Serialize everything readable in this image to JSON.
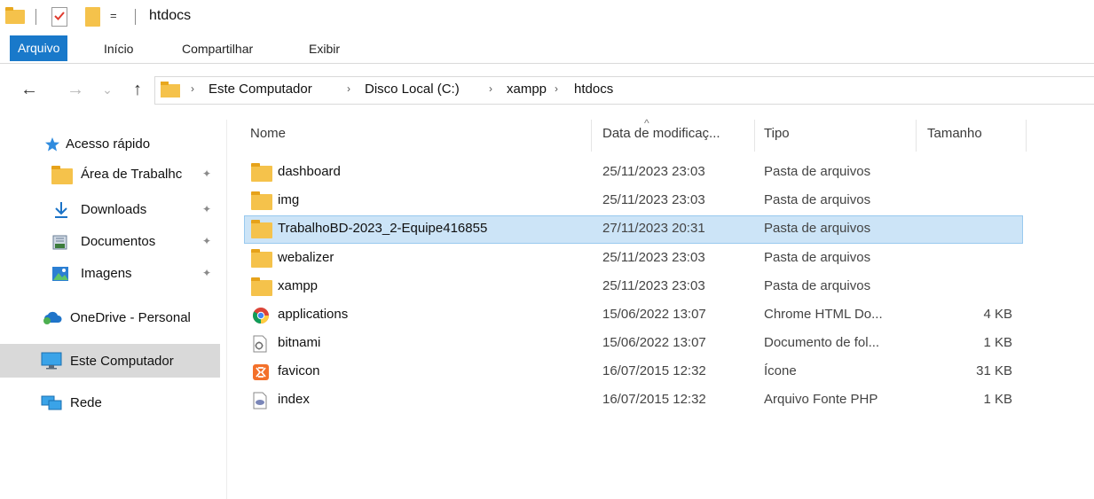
{
  "window": {
    "title": "htdocs",
    "quick_access_dropdown": "="
  },
  "ribbon": {
    "tabs": [
      {
        "label": "Arquivo",
        "active": true
      },
      {
        "label": "Início",
        "active": false
      },
      {
        "label": "Compartilhar",
        "active": false
      },
      {
        "label": "Exibir",
        "active": false
      }
    ]
  },
  "nav": {
    "back": "←",
    "forward": "→",
    "recent": "⌄",
    "up": "↑",
    "breadcrumb": [
      "Este Computador",
      "Disco Local (C:)",
      "xampp",
      "htdocs"
    ],
    "separator": "›"
  },
  "sidebar": {
    "items": [
      {
        "label": "Acesso rápido",
        "icon": "star-icon"
      },
      {
        "label": "Área de Trabalhc",
        "icon": "folder-icon",
        "pinned": true
      },
      {
        "label": "Downloads",
        "icon": "download-icon",
        "pinned": true
      },
      {
        "label": "Documentos",
        "icon": "documents-icon",
        "pinned": true
      },
      {
        "label": "Imagens",
        "icon": "images-icon",
        "pinned": true
      },
      {
        "label": "OneDrive - Personal",
        "icon": "onedrive-icon"
      },
      {
        "label": "Este Computador",
        "icon": "computer-icon",
        "selected": true
      },
      {
        "label": "Rede",
        "icon": "network-icon"
      }
    ],
    "pin_glyph": "📌"
  },
  "list": {
    "sort_indicator": "^",
    "columns": {
      "name": "Nome",
      "date": "Data de modificaç...",
      "type": "Tipo",
      "size": "Tamanho"
    },
    "rows": [
      {
        "name": "dashboard",
        "date": "25/11/2023 23:03",
        "type": "Pasta de arquivos",
        "size": "",
        "icon": "folder-icon"
      },
      {
        "name": "img",
        "date": "25/11/2023 23:03",
        "type": "Pasta de arquivos",
        "size": "",
        "icon": "folder-icon"
      },
      {
        "name": "TrabalhoBD-2023_2-Equipe416855",
        "date": "27/11/2023 20:31",
        "type": "Pasta de arquivos",
        "size": "",
        "icon": "folder-icon",
        "selected": true
      },
      {
        "name": "webalizer",
        "date": "25/11/2023 23:03",
        "type": "Pasta de arquivos",
        "size": "",
        "icon": "folder-icon"
      },
      {
        "name": "xampp",
        "date": "25/11/2023 23:03",
        "type": "Pasta de arquivos",
        "size": "",
        "icon": "folder-icon"
      },
      {
        "name": "applications",
        "date": "15/06/2022 13:07",
        "type": "Chrome HTML Do...",
        "size": "4 KB",
        "icon": "chrome-icon"
      },
      {
        "name": "bitnami",
        "date": "15/06/2022 13:07",
        "type": "Documento de fol...",
        "size": "1 KB",
        "icon": "stylesheet-file-icon"
      },
      {
        "name": "favicon",
        "date": "16/07/2015 12:32",
        "type": "Ícone",
        "size": "31 KB",
        "icon": "xampp-icon"
      },
      {
        "name": "index",
        "date": "16/07/2015 12:32",
        "type": "Arquivo Fonte PHP",
        "size": "1 KB",
        "icon": "php-file-icon"
      }
    ]
  },
  "colors": {
    "accent": "#1979ca",
    "selection_bg": "#cce4f7",
    "selection_border": "#99c9ef",
    "folder": "#f5c24b",
    "sidebar_selected": "#d9d9d9"
  }
}
